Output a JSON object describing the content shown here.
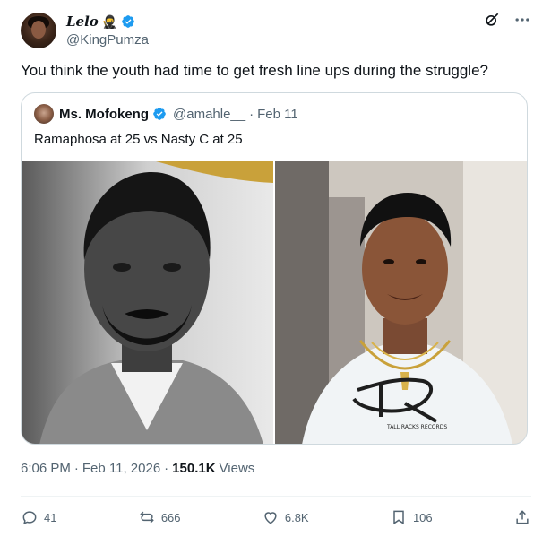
{
  "author": {
    "display_name": "Lelo",
    "emoji": "🥷",
    "handle": "@KingPumza",
    "verified_color": "#1d9bf0"
  },
  "tweet": {
    "text": "You think the youth had time to get fresh line ups during the struggle?",
    "time": "6:06 PM",
    "date": "Feb 11, 2026",
    "views_count": "150.1K",
    "views_label": "Views"
  },
  "quote": {
    "display_name": "Ms. Mofokeng",
    "handle": "@amahle__",
    "separator": "·",
    "date": "Feb 11",
    "text": "Ramaphosa at 25 vs Nasty C at 25",
    "images": [
      {
        "alt_semantic": "Ramaphosa at 25 black and white portrait",
        "tone": "grayscale"
      },
      {
        "alt_semantic": "Nasty C at 25 photo",
        "tone": "color"
      }
    ],
    "watermark": "TALL RACKS RECORDS"
  },
  "actions": {
    "reply_count": "41",
    "repost_count": "666",
    "like_count": "6.8K",
    "bookmark_count": "106"
  },
  "icons": {
    "grok": "grok-icon",
    "more": "more-icon",
    "reply": "reply-icon",
    "repost": "repost-icon",
    "like": "heart-icon",
    "bookmark": "bookmark-icon",
    "share": "share-icon"
  },
  "colors": {
    "text": "#0f1419",
    "muted": "#536471",
    "border": "#cfd9de",
    "accent": "#1d9bf0"
  }
}
